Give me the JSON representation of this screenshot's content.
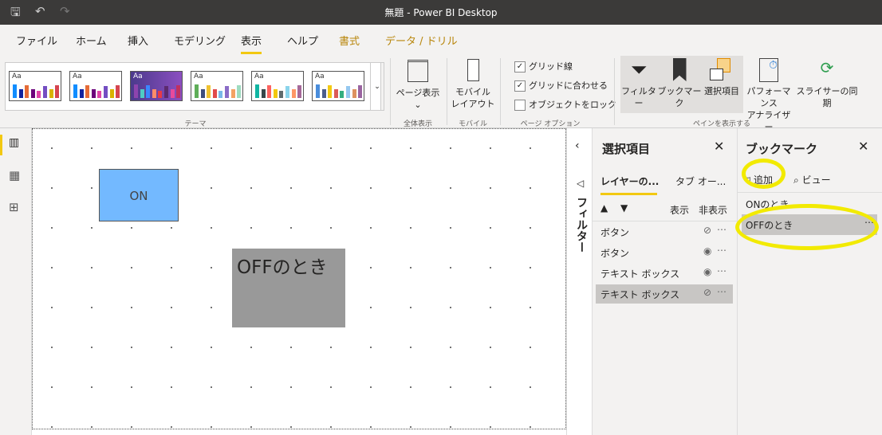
{
  "window": {
    "title": "無題 - Power BI Desktop"
  },
  "tabs": [
    "ファイル",
    "ホーム",
    "挿入",
    "モデリング",
    "表示",
    "ヘルプ",
    "書式",
    "データ / ドリル"
  ],
  "ribbon": {
    "themes_label": "テーマ",
    "theme_sample": "Aa",
    "page_view": "ページ表示",
    "page_view_group": "全体表示",
    "mobile_layout": [
      "モバイル",
      "レイアウト"
    ],
    "mobile_group": "モバイル",
    "gridlines": "グリッド線",
    "snap": "グリッドに合わせる",
    "lock": "オブジェクトをロック",
    "page_options_group": "ページ オプション",
    "gridlines_checked": true,
    "snap_checked": true,
    "lock_checked": false,
    "filters": "フィルター",
    "bookmarks": "ブックマーク",
    "selection": "選択項目",
    "perf": [
      "パフォーマンス",
      "アナライザー"
    ],
    "sync": "スライサーの同期",
    "panes_group": "ペインを表示する"
  },
  "canvas": {
    "on_button": "ON",
    "off_text": "OFFのとき"
  },
  "filter_pane": {
    "label": "フィルター"
  },
  "selection_pane": {
    "title": "選択項目",
    "tab_layer": "レイヤーの...",
    "tab_order": "タブ オー...",
    "show": "表示",
    "hide": "非表示",
    "items": [
      {
        "label": "ボタン",
        "hidden": true
      },
      {
        "label": "ボタン",
        "hidden": false
      },
      {
        "label": "テキスト ボックス",
        "hidden": false
      },
      {
        "label": "テキスト ボックス",
        "hidden": true,
        "selected": true
      }
    ]
  },
  "bookmark_pane": {
    "title": "ブックマーク",
    "add": "追加",
    "view": "ビュー",
    "items": [
      "ONのとき",
      "OFFのとき"
    ],
    "selected": "OFFのとき"
  },
  "colors": {
    "accent": "#f2c811",
    "on_button": "#73b9ff",
    "off_box": "#999999",
    "highlight": "#f2ea00"
  }
}
